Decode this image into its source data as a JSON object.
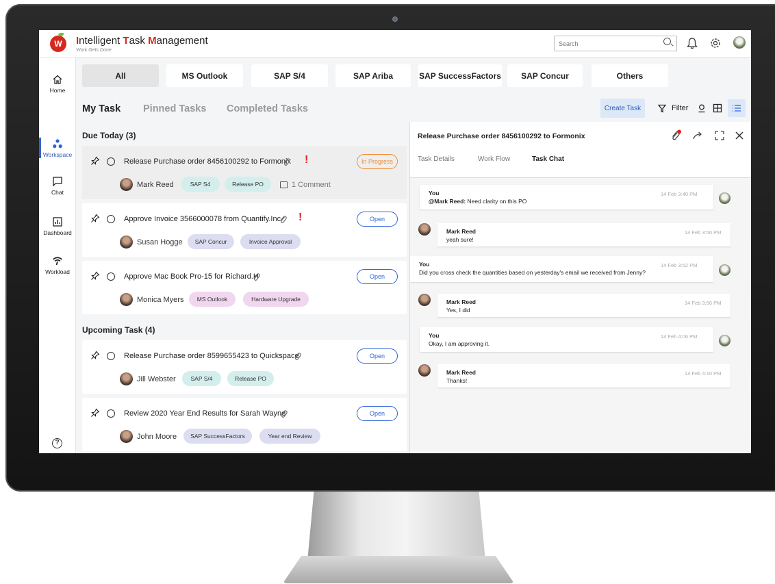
{
  "header": {
    "title_parts": [
      {
        "t": "I",
        "red": true
      },
      {
        "t": "ntelligent ",
        "red": false
      },
      {
        "t": "T",
        "red": true
      },
      {
        "t": "ask ",
        "red": false
      },
      {
        "t": "M",
        "red": true
      },
      {
        "t": "anagement",
        "red": false
      }
    ],
    "logo_letter": "W",
    "tagline": "Work Gets Done",
    "search_placeholder": "Search"
  },
  "nav": {
    "items": [
      {
        "label": "Home",
        "icon": "home-icon"
      },
      {
        "label": "Workspace",
        "icon": "workspace-icon",
        "active": true
      },
      {
        "label": "Chat",
        "icon": "chat-icon"
      },
      {
        "label": "Dashboard",
        "icon": "dashboard-icon"
      },
      {
        "label": "Workload",
        "icon": "workload-icon"
      }
    ],
    "help_label": "?"
  },
  "categories": [
    "All",
    "MS Outlook",
    "SAP S/4",
    "SAP Ariba",
    "SAP SuccessFactors",
    "SAP Concur",
    "Others"
  ],
  "subtabs": [
    "My Task",
    "Pinned Tasks",
    "Completed Tasks"
  ],
  "toolbar": {
    "create_label": "Create Task",
    "filter_label": "Filter"
  },
  "sections": {
    "today": "Due Today (3)",
    "upcoming": "Upcoming Task (4)"
  },
  "tasks": [
    {
      "title": "Release Purchase order 8456100292 to Formonix",
      "status": "In Progress",
      "person": "Mark Reed",
      "tags": [
        "SAP S4",
        "Release PO"
      ],
      "comment": "1 Comment",
      "urgent": true
    },
    {
      "title": "Approve Invoice 3566000078 from Quantify.Inc",
      "status": "Open",
      "person": "Susan Hogge",
      "tags": [
        "SAP Concur",
        "Invoice Approval"
      ],
      "urgent": true
    },
    {
      "title": "Approve Mac Book Pro-15 for Richard.H",
      "status": "Open",
      "person": "Monica Myers",
      "tags": [
        "MS Outlook",
        "Hardware Upgrade"
      ],
      "urgent": false
    },
    {
      "title": "Release Purchase order 8599655423 to Quickspace",
      "status": "Open",
      "person": "Jill Webster",
      "tags": [
        "SAP S/4",
        "Release PO"
      ],
      "urgent": false
    },
    {
      "title": "Review 2020 Year End Results for Sarah Wayne",
      "status": "Open",
      "person": "John Moore",
      "tags": [
        "SAP SuccessFactors",
        "Year end Review"
      ],
      "urgent": false
    }
  ],
  "colors": {
    "tag_teal": "#d3eeed",
    "tag_lavender": "#dcddf1",
    "tag_pink": "#f0d6ee",
    "accent_blue": "#2e63d6",
    "progress_orange": "#f28b30",
    "urgent_red": "#e02020"
  },
  "detail": {
    "title": "Release Purchase order 8456100292 to Formonix",
    "tabs": [
      "Task Details",
      "Work Flow",
      "Task Chat"
    ],
    "messages": [
      {
        "from": "You",
        "mention": "@Mark Reed:",
        "text": " Need clarity on this PO",
        "time": "14 Feb 3:40 PM"
      },
      {
        "from": "Mark Reed",
        "text": "yeah sure!",
        "time": "14 Feb 3:50 PM"
      },
      {
        "from": "You",
        "text": "Did you cross check the quantities based on yesterday's email we received from Jenny?",
        "time": "14 Feb 3:52 PM"
      },
      {
        "from": "Mark Reed",
        "text": "Yes, I did",
        "time": "14 Feb 3:56 PM"
      },
      {
        "from": "You",
        "text": "Okay, I am approving it.",
        "time": "14 Feb 4:06 PM"
      },
      {
        "from": "Mark Reed",
        "text": "Thanks!",
        "time": "14 Feb 4:10 PM"
      }
    ]
  }
}
